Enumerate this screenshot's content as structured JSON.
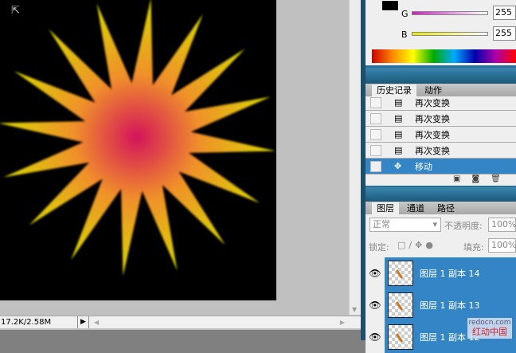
{
  "document": {
    "status_size": "17.2K/2.58M",
    "colors": {
      "center": "#d4145a",
      "mid": "#f0902a",
      "tip": "#d8d800"
    }
  },
  "color_panel": {
    "g_label": "G",
    "g_value": "255",
    "b_label": "B",
    "b_value": "255"
  },
  "history_panel": {
    "tabs": [
      {
        "label": "历史记录",
        "active": true
      },
      {
        "label": "动作",
        "active": false
      }
    ],
    "items": [
      {
        "label": "再次变换",
        "icon": "transform-icon"
      },
      {
        "label": "再次变换",
        "icon": "transform-icon"
      },
      {
        "label": "再次变换",
        "icon": "transform-icon"
      },
      {
        "label": "再次变换",
        "icon": "transform-icon"
      },
      {
        "label": "移动",
        "icon": "move-icon",
        "selected": true
      }
    ]
  },
  "layers_panel": {
    "tabs": [
      {
        "label": "图层",
        "active": true
      },
      {
        "label": "通道"
      },
      {
        "label": "路径"
      }
    ],
    "blend_mode": "正常",
    "opacity_label": "不透明度:",
    "opacity_value": "100%",
    "lock_label": "锁定:",
    "fill_label": "填充:",
    "fill_value": "100%",
    "layers": [
      {
        "name": "图层 1 副本 14",
        "visible": true
      },
      {
        "name": "图层 1 副本 13",
        "visible": true
      },
      {
        "name": "图层 1 副本 12",
        "visible": true
      }
    ]
  },
  "watermark": {
    "url": "redocn.com",
    "text": "红动中国"
  }
}
